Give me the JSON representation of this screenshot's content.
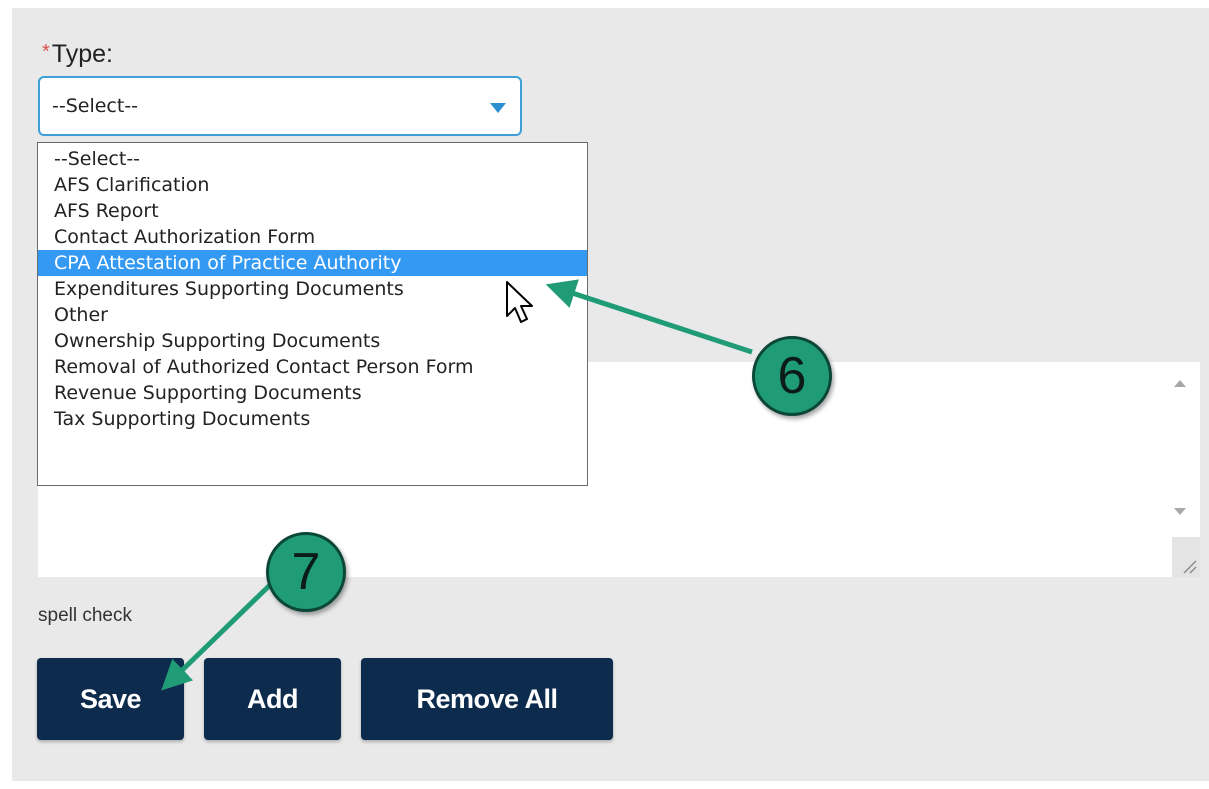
{
  "form": {
    "required_marker": "*",
    "type_label": "Type:",
    "select_value": "--Select--",
    "options": [
      "--Select--",
      "AFS Clarification",
      "AFS Report",
      "Contact Authorization Form",
      "CPA Attestation of Practice Authority",
      "Expenditures Supporting Documents",
      "Other",
      "Ownership Supporting Documents",
      "Removal of Authorized Contact Person Form",
      "Revenue Supporting Documents",
      "Tax Supporting Documents"
    ],
    "highlighted_option": "CPA Attestation of Practice Authority",
    "spell_check": "spell check"
  },
  "buttons": {
    "save": "Save",
    "add": "Add",
    "remove_all": "Remove All"
  },
  "annotations": {
    "step_6": "6",
    "step_7": "7",
    "color": "#1f9b76"
  },
  "colors": {
    "button_bg": "#0d2b4d",
    "highlight": "#3399f3",
    "select_border": "#3fa0d8"
  }
}
